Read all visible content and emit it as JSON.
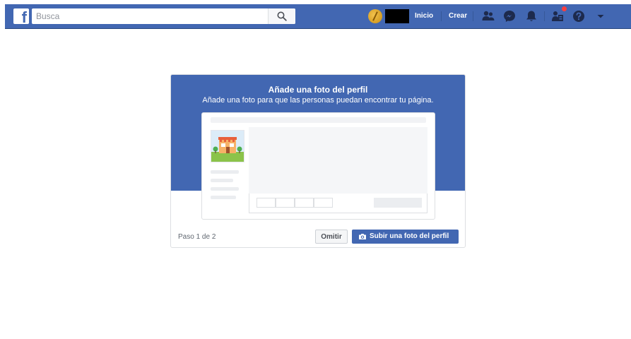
{
  "topbar": {
    "search_placeholder": "Busca",
    "nav_home": "Inicio",
    "nav_create": "Crear",
    "colors": {
      "bar": "#4267b2",
      "notification": "#fa3e3e"
    },
    "icons": [
      "facebook-logo-icon",
      "search-icon",
      "friend-requests-icon",
      "messenger-icon",
      "notifications-icon",
      "pages-icon",
      "help-icon",
      "caret-down-icon"
    ]
  },
  "card": {
    "title": "Añade una foto del perfil",
    "subtitle": "Añade una foto para que las personas puedan encontrar tu página.",
    "step": "Paso 1 de 2",
    "skip_label": "Omitir",
    "upload_label": "Subir una foto del perfil",
    "upload_icon": "camera-icon"
  }
}
